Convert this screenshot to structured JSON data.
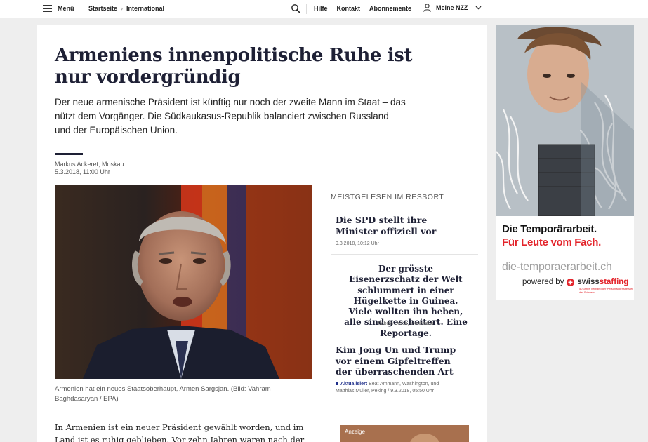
{
  "nav": {
    "menu_label": "Menü",
    "breadcrumbs": [
      "Startseite",
      "International"
    ],
    "links": [
      "Hilfe",
      "Kontakt",
      "Abonnemente"
    ],
    "account_label": "Meine NZZ"
  },
  "article": {
    "title": "Armeniens innenpolitische Ruhe ist nur vordergründig",
    "lead": "Der neue armenische Präsident ist künftig nur noch der zweite Mann im Staat – das nützt dem Vorgänger. Die Südkaukasus-Republik balanciert zwischen Russland und der Europäischen Union.",
    "author": "Markus Ackeret, Moskau",
    "date": "5.3.2018, 11:00 Uhr",
    "caption": "Armenien hat ein neues Staatsoberhaupt, Armen Sargsjan. (Bild: Vahram Baghdasaryan / EPA)",
    "body": "In Armenien ist ein neuer Präsident gewählt worden, und im Land ist es ruhig geblieben. Vor zehn Jahren waren nach der Wahl Sersch"
  },
  "most_read": {
    "heading": "MEISTGELESEN IM RESSORT",
    "items": [
      {
        "title": "Die SPD stellt ihre Minister offiziell vor",
        "meta": "9.3.2018, 10:12 Uhr"
      },
      {
        "title": "Der grösste Eisenerzschatz der Welt schlummert in einer Hügelkette in Guinea. Viele wollten ihn heben, alle sind gescheitert. Eine Reportage.",
        "meta": "Fabian Urech, Moribadou"
      },
      {
        "title": "Kim Jong Un und Trump vor einem Gipfeltreffen der überraschenden Art",
        "status": "Aktualisiert",
        "meta": "Beat Ammann, Washington, und Matthias Müller, Peking / 9.3.2018, 05:50 Uhr"
      }
    ],
    "ad_label": "Anzeige"
  },
  "ad": {
    "line1": "Die Temporärarbeit.",
    "line2": "Für Leute vom Fach.",
    "url": "die-temporaerarbeit.ch",
    "powered": "powered by",
    "brand_a": "swiss",
    "brand_b": "staffing",
    "brand_small": "50 Jahre Verband der Personaldienstleister der Schweiz",
    "colors": {
      "red": "#e3242b",
      "navy": "#1e2035"
    }
  }
}
